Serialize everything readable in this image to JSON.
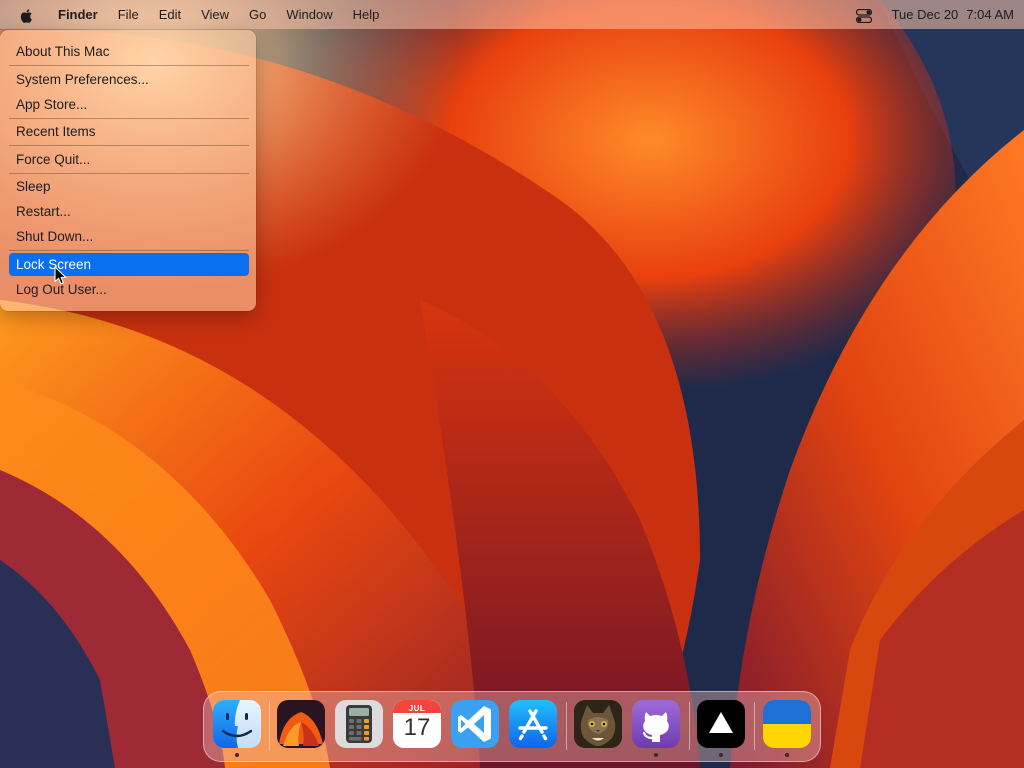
{
  "menubar": {
    "apple_icon": "apple-logo-icon",
    "app_name": "Finder",
    "menus": [
      "File",
      "Edit",
      "View",
      "Go",
      "Window",
      "Help"
    ],
    "control_center_icon": "control-center-icon",
    "date": "Tue Dec 20",
    "time": "7:04 AM"
  },
  "apple_menu": {
    "items": [
      {
        "label": "About This Mac"
      },
      {
        "label": "System Preferences..."
      },
      {
        "label": "App Store..."
      },
      {
        "label": "Recent Items"
      },
      {
        "label": "Force Quit..."
      },
      {
        "label": "Sleep"
      },
      {
        "label": "Restart..."
      },
      {
        "label": "Shut Down..."
      },
      {
        "label": "Lock Screen",
        "selected": true
      },
      {
        "label": "Log Out User..."
      }
    ]
  },
  "dock": {
    "apps": [
      {
        "icon": "finder-icon",
        "running": true
      },
      {
        "icon": "ventura-wallpaper-icon",
        "running": false
      },
      {
        "icon": "calculator-icon",
        "running": false
      },
      {
        "icon": "calendar-icon",
        "running": false,
        "month": "JUL",
        "day": "17"
      },
      {
        "icon": "vscode-icon",
        "running": false
      },
      {
        "icon": "app-store-icon",
        "running": false
      },
      {
        "icon": "cat-photo-icon",
        "running": false
      },
      {
        "icon": "github-octocat-icon",
        "running": true
      },
      {
        "icon": "vercel-triangle-icon",
        "running": true
      },
      {
        "icon": "ukraine-flag-icon",
        "running": true
      }
    ]
  },
  "colors": {
    "selection": "#0a6ff0",
    "wallpaper_primary": "#f05a12",
    "wallpaper_shadow": "#5a1418"
  }
}
